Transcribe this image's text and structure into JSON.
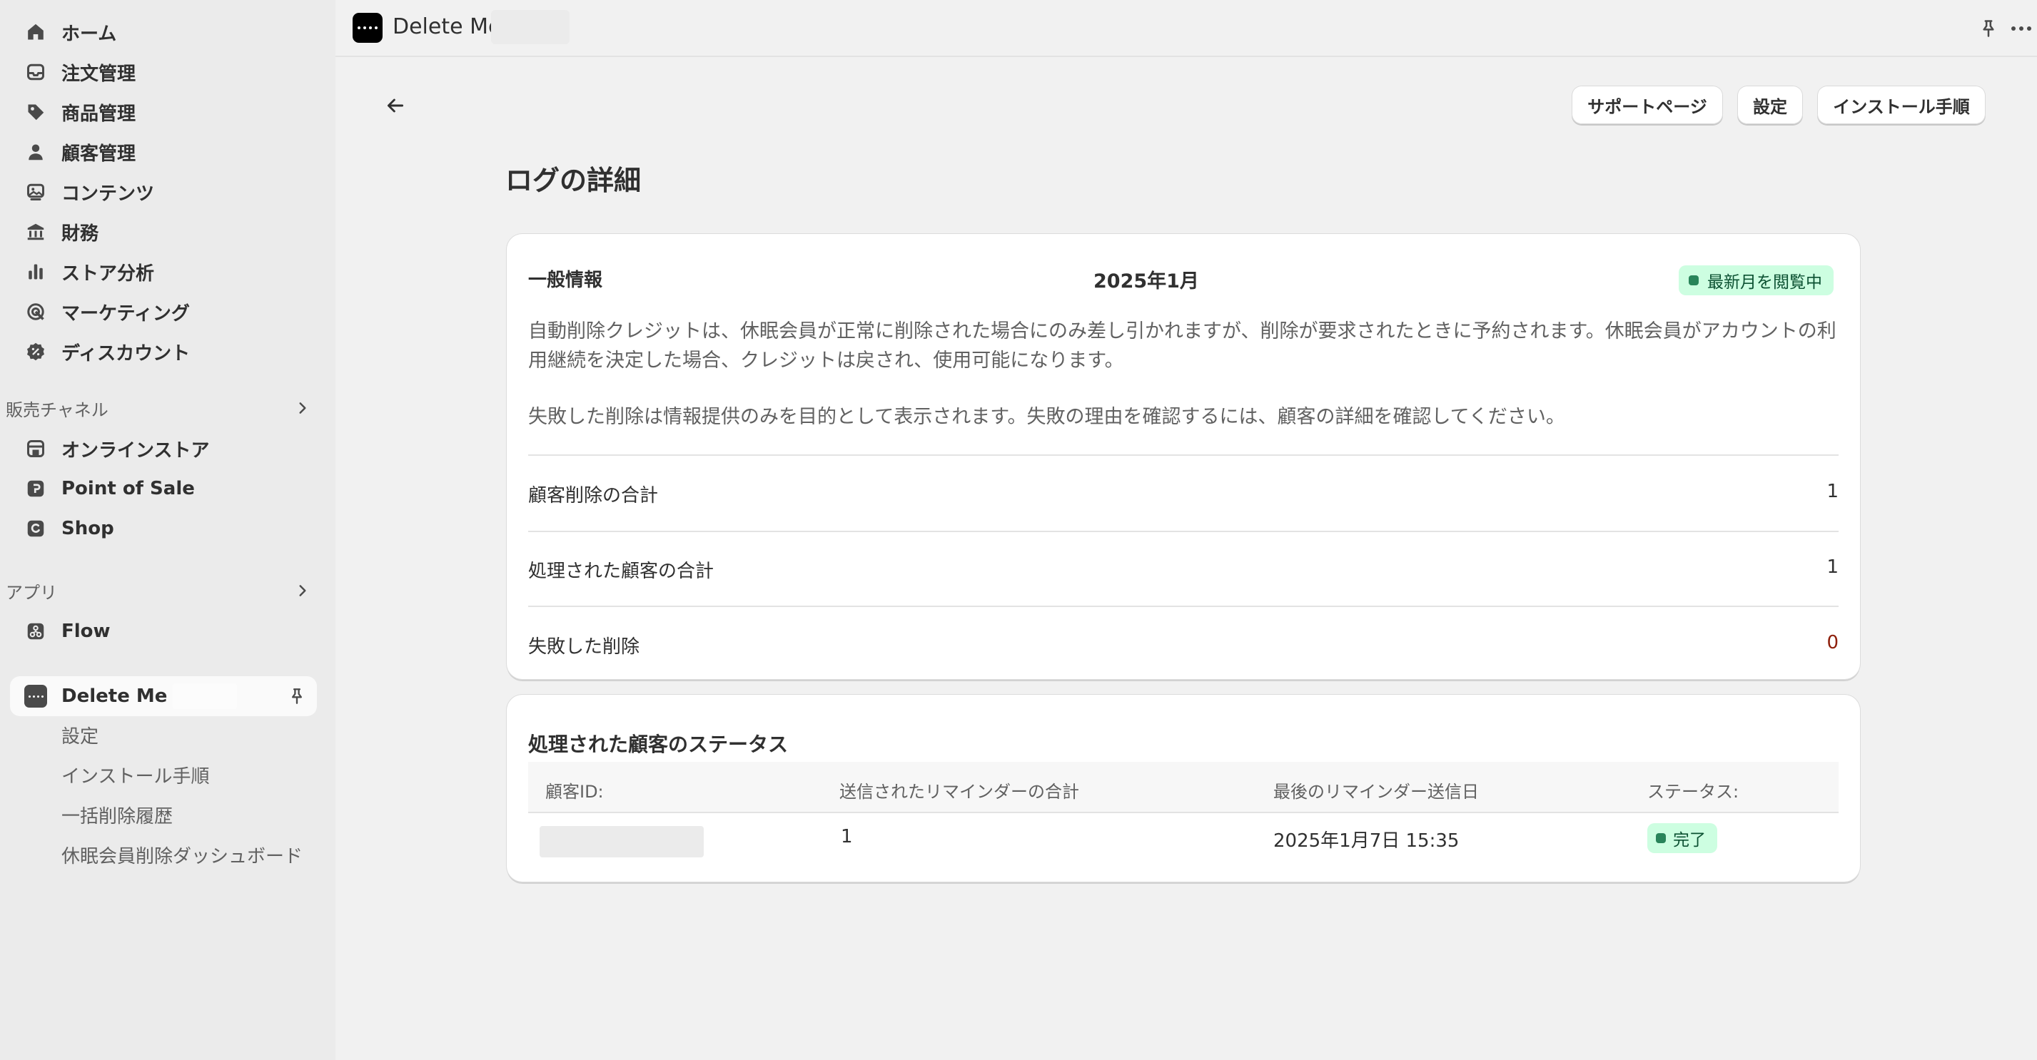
{
  "sidebar": {
    "nav": [
      {
        "label": "ホーム",
        "icon": "home-icon"
      },
      {
        "label": "注文管理",
        "icon": "inbox-icon"
      },
      {
        "label": "商品管理",
        "icon": "tag-icon"
      },
      {
        "label": "顧客管理",
        "icon": "person-icon"
      },
      {
        "label": "コンテンツ",
        "icon": "image-icon"
      },
      {
        "label": "財務",
        "icon": "bank-icon"
      },
      {
        "label": "ストア分析",
        "icon": "bar-chart-icon"
      },
      {
        "label": "マーケティング",
        "icon": "target-icon"
      },
      {
        "label": "ディスカウント",
        "icon": "discount-icon"
      }
    ],
    "sales_channels": {
      "label": "販売チャネル",
      "items": [
        {
          "label": "オンラインストア",
          "icon": "store-icon"
        },
        {
          "label": "Point of Sale",
          "icon": "pos-icon"
        },
        {
          "label": "Shop",
          "icon": "shop-icon"
        }
      ]
    },
    "apps": {
      "label": "アプリ",
      "items": [
        {
          "label": "Flow",
          "icon": "flow-icon"
        }
      ],
      "active_app": {
        "label": "Delete Me",
        "sub_items": [
          "設定",
          "インストール手順",
          "一括削除履歴",
          "休眠会員削除ダッシュボード"
        ]
      }
    }
  },
  "topbar": {
    "app_name": "Delete Me"
  },
  "header": {
    "title": "ログの詳細",
    "buttons": {
      "support": "サポートページ",
      "settings": "設定",
      "install": "インストール手順"
    }
  },
  "general_info": {
    "heading": "一般情報",
    "month": "2025年1月",
    "badge": "最新月を閲覧中",
    "description_1": "自動削除クレジットは、休眠会員が正常に削除された場合にのみ差し引かれますが、削除が要求されたときに予約されます。休眠会員がアカウントの利用継続を決定した場合、クレジットは戻され、使用可能になります。",
    "description_2": "失敗した削除は情報提供のみを目的として表示されます。失敗の理由を確認するには、顧客の詳細を確認してください。",
    "stats": [
      {
        "label": "顧客削除の合計",
        "value": "1"
      },
      {
        "label": "処理された顧客の合計",
        "value": "1"
      },
      {
        "label": "失敗した削除",
        "value": "0"
      }
    ]
  },
  "status_table": {
    "title": "処理された顧客のステータス",
    "columns": [
      "顧客ID:",
      "送信されたリマインダーの合計",
      "最後のリマインダー送信日",
      "ステータス:"
    ],
    "rows": [
      {
        "customer_id": "",
        "reminders": "1",
        "last_sent": "2025年1月7日 15:35",
        "status": "完了"
      }
    ]
  },
  "colors": {
    "success_bg": "#cdfee1",
    "success_fg": "#0c5132",
    "critical_text": "#8e1f0b"
  }
}
